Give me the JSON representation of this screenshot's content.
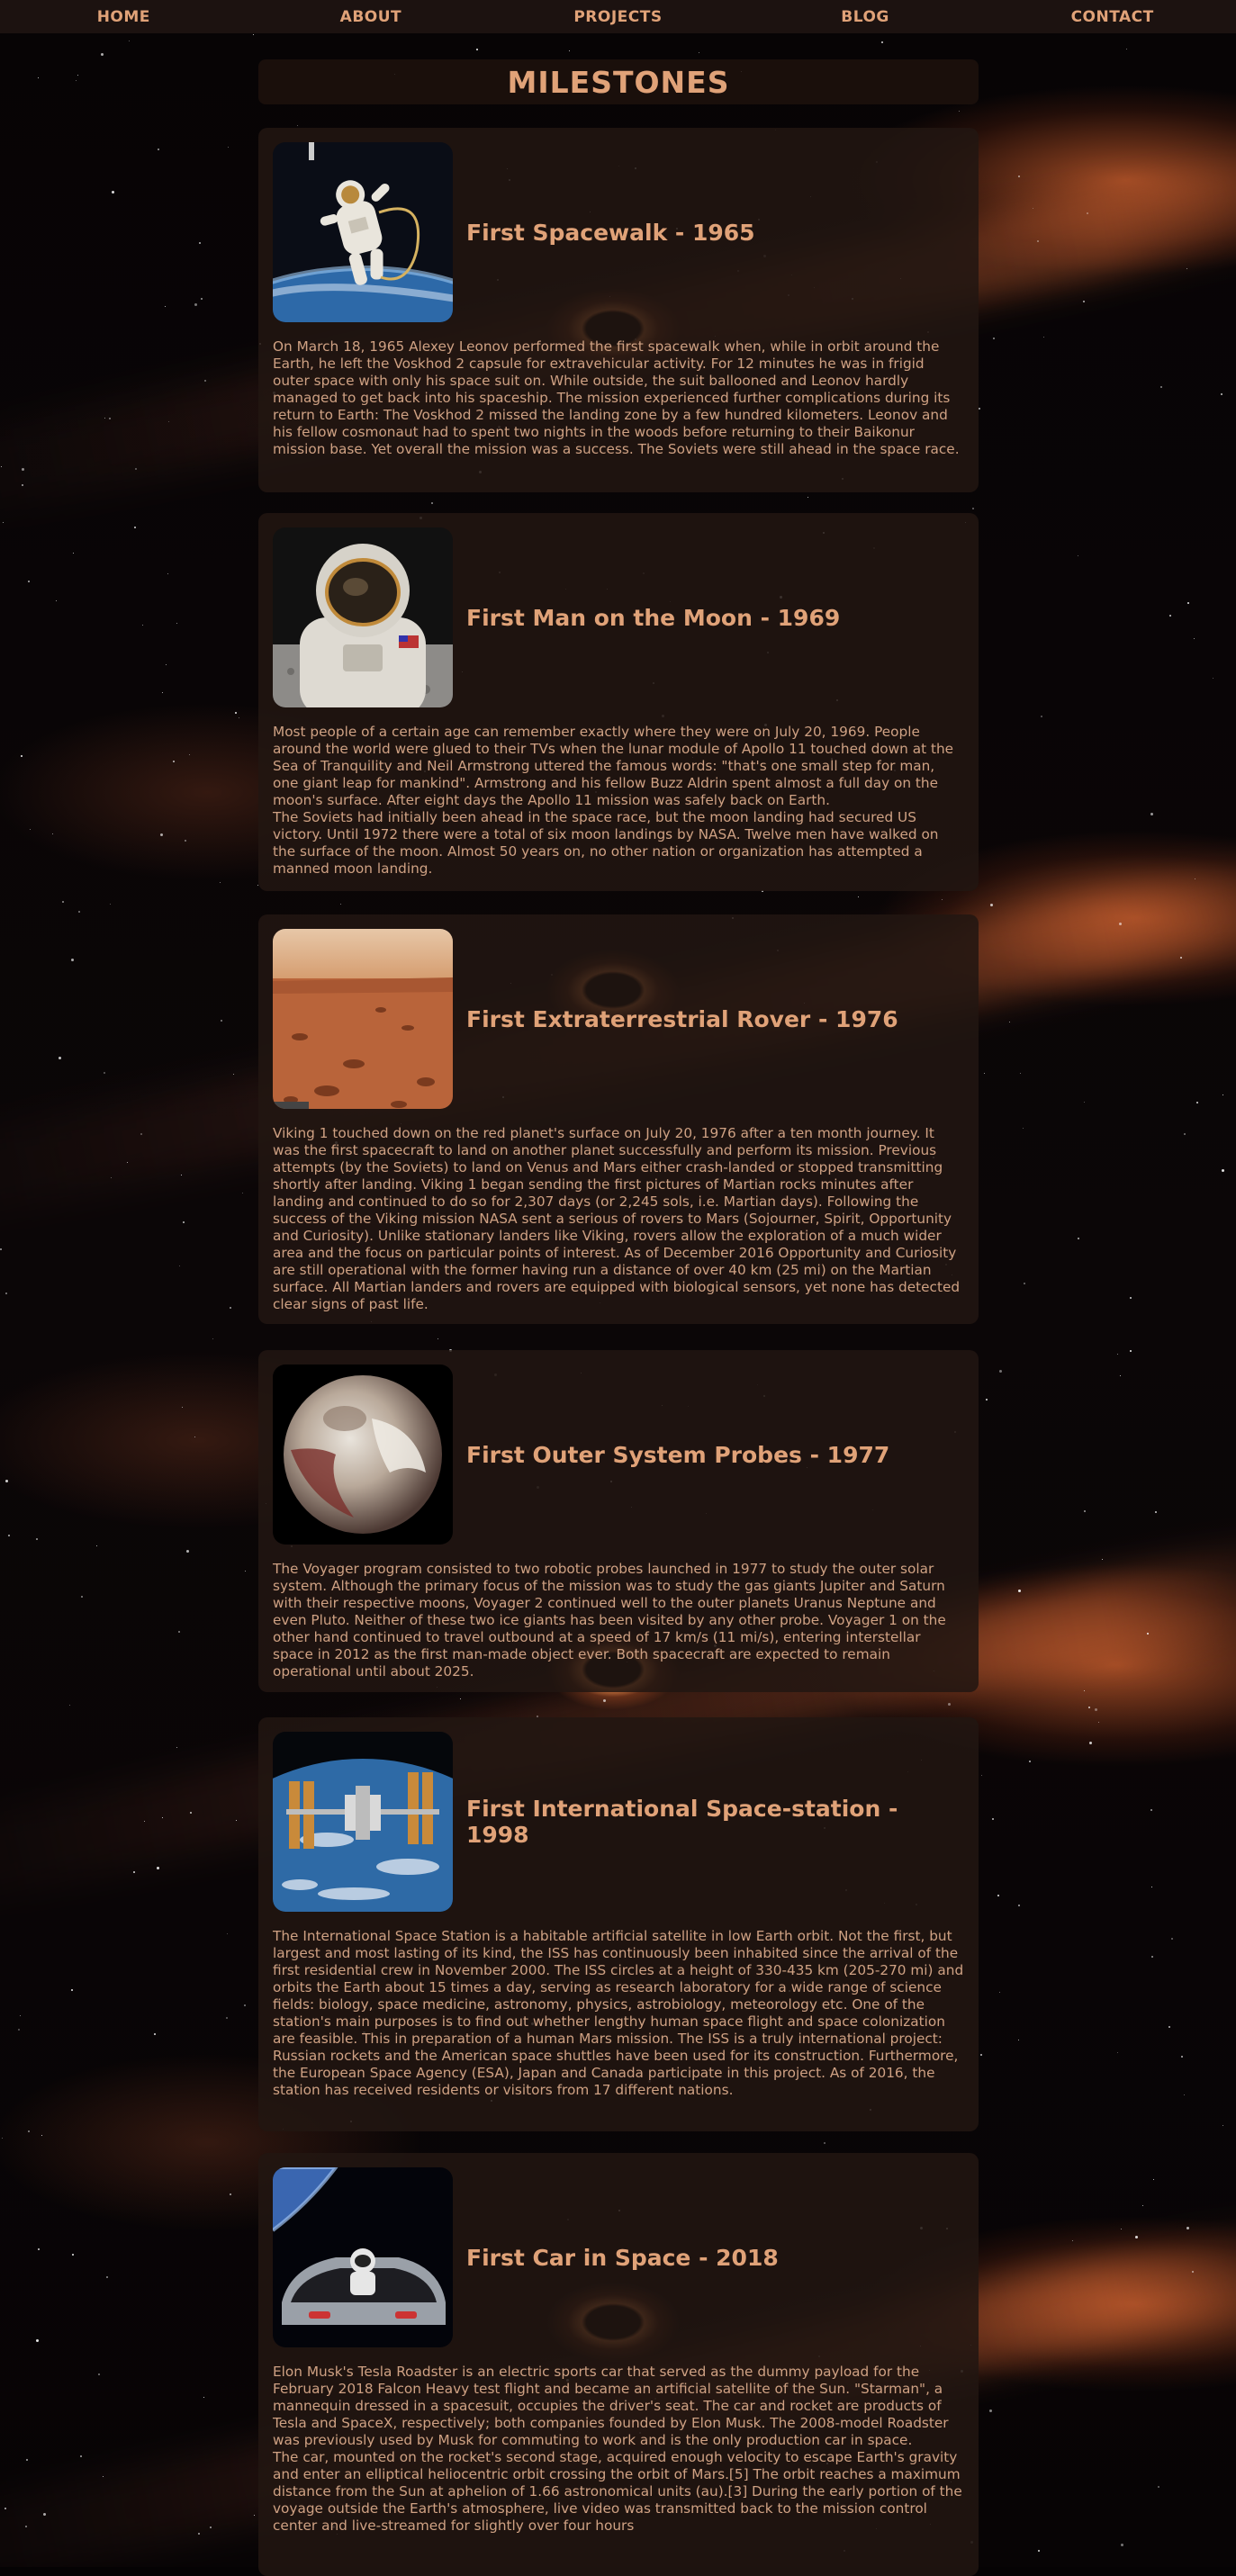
{
  "nav": {
    "items": [
      "HOME",
      "ABOUT",
      "PROJECTS",
      "BLOG",
      "CONTACT"
    ]
  },
  "page": {
    "title": "MILESTONES"
  },
  "milestones": [
    {
      "title": "First Spacewalk - 1965",
      "image_icon": "astronaut-spacewalk-image",
      "text": "On March 18, 1965 Alexey Leonov performed the first spacewalk when, while in orbit around the Earth, he left the Voskhod 2 capsule for extravehicular activity. For 12 minutes he was in frigid outer space with only his space suit on. While outside, the suit ballooned and Leonov hardly managed to get back into his spaceship. The mission experienced further complications during its return to Earth: The Voskhod 2 missed the landing zone by a few hundred kilometers. Leonov and his fellow cosmonaut had to spent two nights in the woods before returning to their Baikonur mission base. Yet overall the mission was a success. The Soviets were still ahead in the space race."
    },
    {
      "title": "First Man on the Moon - 1969",
      "image_icon": "moon-astronaut-image",
      "text": "Most people of a certain age can remember exactly where they were on July 20, 1969. People around the world were glued to their TVs when the lunar module of Apollo 11 touched down at the Sea of Tranquility and Neil Armstrong uttered the famous words: \"that's one small step for man, one giant leap for mankind\". Armstrong and his fellow Buzz Aldrin spent almost a full day on the moon's surface. After eight days the Apollo 11 mission was safely back on Earth.\nThe Soviets had initially been ahead in the space race, but the moon landing had secured US victory. Until 1972 there were a total of six moon landings by NASA. Twelve men have walked on the surface of the moon. Almost 50 years on, no other nation or organization has attempted a manned moon landing."
    },
    {
      "title": "First Extraterrestrial Rover - 1976",
      "image_icon": "mars-surface-image",
      "text": "Viking 1 touched down on the red planet's surface on July 20, 1976 after a ten month journey. It was the first spacecraft to land on another planet successfully and perform its mission. Previous attempts (by the Soviets) to land on Venus and Mars either crash-landed or stopped transmitting shortly after landing. Viking 1 began sending the first pictures of Martian rocks minutes after landing and continued to do so for 2,307 days (or 2,245 sols, i.e. Martian days). Following the success of the Viking mission NASA sent a serious of rovers to Mars (Sojourner, Spirit, Opportunity and Curiosity). Unlike stationary landers like Viking, rovers allow the exploration of a much wider area and the focus on particular points of interest. As of December 2016 Opportunity and Curiosity are still operational with the former having run a distance of over 40 km (25 mi) on the Martian surface. All Martian landers and rovers are equipped with biological sensors, yet none has detected clear signs of past life."
    },
    {
      "title": "First Outer System Probes - 1977",
      "image_icon": "pluto-planet-image",
      "text": "The Voyager program consisted to two robotic probes launched in 1977 to study the outer solar system. Although the primary focus of the mission was to study the gas giants Jupiter and Saturn with their respective moons, Voyager 2 continued well to the outer planets Uranus Neptune and even Pluto. Neither of these two ice giants has been visited by any other probe. Voyager 1 on the other hand continued to travel outbound at a speed of 17 km/s (11 mi/s), entering interstellar space in 2012 as the first man-made object ever. Both spacecraft are expected to remain operational until about 2025."
    },
    {
      "title": "First International Space-station - 1998",
      "image_icon": "space-station-image",
      "text": "The International Space Station is a habitable artificial satellite in low Earth orbit. Not the first, but largest and most lasting of its kind, the ISS has continuously been inhabited since the arrival of the first residential crew in November 2000. The ISS circles at a height of 330-435 km (205-270 mi) and orbits the Earth about 15 times a day, serving as research laboratory for a wide range of science fields: biology, space medicine, astronomy, physics, astrobiology, meteorology etc. One of the station's main purposes is to find out whether lengthy human space flight and space colonization are feasible. This in preparation of a human Mars mission. The ISS is a truly international project: Russian rockets and the American space shuttles have been used for its construction. Furthermore, the European Space Agency (ESA), Japan and Canada participate in this project. As of 2016, the station has received residents or visitors from 17 different nations."
    },
    {
      "title": "First Car in Space - 2018",
      "image_icon": "tesla-roadster-image",
      "text": "Elon Musk's Tesla Roadster is an electric sports car that served as the dummy payload for the February 2018 Falcon Heavy test flight and became an artificial satellite of the Sun. \"Starman\", a mannequin dressed in a spacesuit, occupies the driver's seat. The car and rocket are products of Tesla and SpaceX, respectively; both companies founded by Elon Musk. The 2008-model Roadster was previously used by Musk for commuting to work and is the only production car in space.\nThe car, mounted on the rocket's second stage, acquired enough velocity to escape Earth's gravity and enter an elliptical heliocentric orbit crossing the orbit of Mars.[5] The orbit reaches a maximum distance from the Sun at aphelion of 1.66 astronomical units (au).[3] During the early portion of the voyage outside the Earth's atmosphere, live video was transmitted back to the mission control center and live-streamed for slightly over four hours"
    }
  ]
}
